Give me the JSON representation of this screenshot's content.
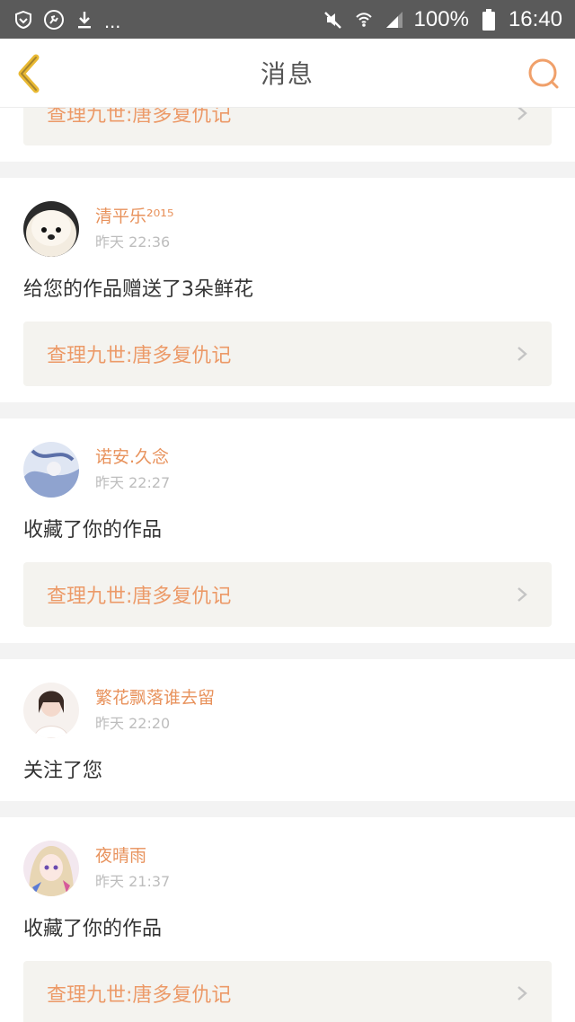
{
  "status_bar": {
    "more": "...",
    "battery": "100%",
    "time": "16:40"
  },
  "header": {
    "title": "消息"
  },
  "partial_top": {
    "work_title": "查理九世:唐多复仇记"
  },
  "messages": [
    {
      "username": "清平乐²⁰¹⁵",
      "time": "昨天 22:36",
      "text": "给您的作品赠送了3朵鲜花",
      "work_title": "查理九世:唐多复仇记"
    },
    {
      "username": "诺安.久念",
      "time": "昨天 22:27",
      "text": "收藏了你的作品",
      "work_title": "查理九世:唐多复仇记"
    },
    {
      "username": "繁花飘落谁去留",
      "time": "昨天 22:20",
      "text": "关注了您"
    },
    {
      "username": "夜晴雨",
      "time": "昨天 21:37",
      "text": "收藏了你的作品",
      "work_title": "查理九世:唐多复仇记"
    }
  ],
  "colors": {
    "accent": "#e8925c",
    "status_bar": "#5a5a5a",
    "back_icon": "#e9b933",
    "link_bg": "#f4f3ef"
  }
}
